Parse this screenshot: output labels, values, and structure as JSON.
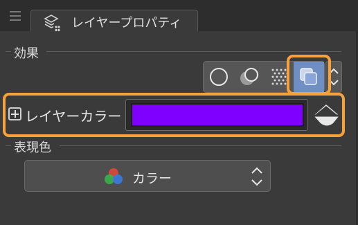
{
  "panel": {
    "title": "レイヤープロパティ",
    "tab_icon": "layer-properties-icon"
  },
  "effect_section": {
    "label": "効果",
    "buttons": [
      {
        "name": "border-effect",
        "icon": "circle-outline-icon"
      },
      {
        "name": "extract-line",
        "icon": "overlap-circles-icon"
      },
      {
        "name": "tone",
        "icon": "dot-tone-icon"
      },
      {
        "name": "layer-color",
        "icon": "layer-color-icon",
        "selected": true
      }
    ]
  },
  "layer_color": {
    "label": "レイヤーカラー",
    "color": "#8000ff",
    "expand_icon": "plus-icon",
    "bucket_icon": "paint-bucket-icon"
  },
  "expression_color": {
    "label": "表現色",
    "value": "カラー",
    "icon": "rgb-color-icon"
  },
  "colors": {
    "highlight": "#f7a13b",
    "selected": "#6f8fc4",
    "background": "#3a3a3a"
  }
}
